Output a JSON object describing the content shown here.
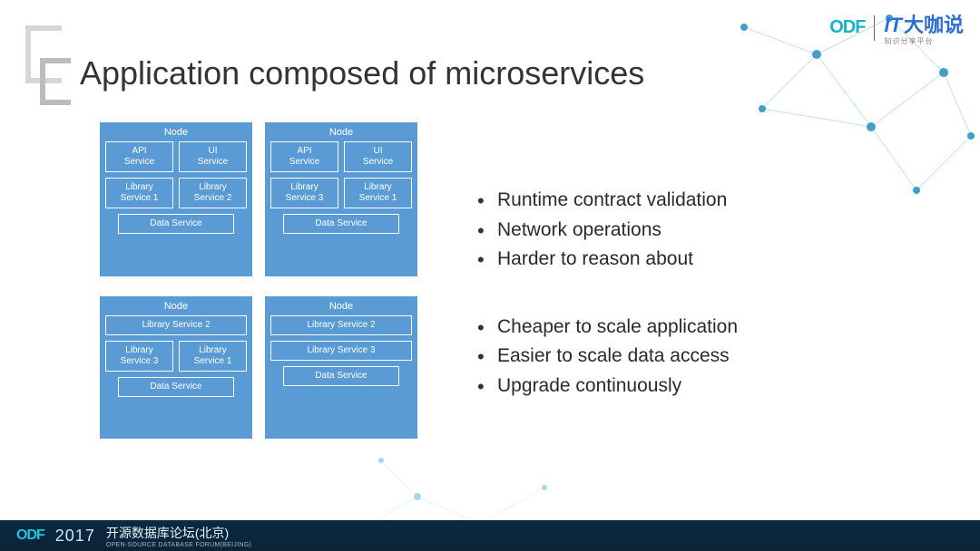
{
  "title": "Application composed of microservices",
  "header": {
    "logo1": "ODF",
    "logo2_it": "IT",
    "logo2_cn": "大咖说",
    "logo2_sub": "知识分享平台"
  },
  "nodes": [
    {
      "title": "Node",
      "rows": [
        [
          "API\nService",
          "UI\nService"
        ],
        [
          "Library\nService 1",
          "Library\nService 2"
        ]
      ],
      "bottom": "Data Service"
    },
    {
      "title": "Node",
      "rows": [
        [
          "API\nService",
          "UI\nService"
        ],
        [
          "Library\nService 3",
          "Library\nService 1"
        ]
      ],
      "bottom": "Data Service"
    },
    {
      "title": "Node",
      "rows": [
        [
          "Library Service 2"
        ],
        [
          "Library\nService 3",
          "Library\nService 1"
        ]
      ],
      "bottom": "Data Service"
    },
    {
      "title": "Node",
      "rows": [
        [
          "Library Service 2"
        ],
        [
          "Library Service 3"
        ]
      ],
      "bottom": "Data Service"
    }
  ],
  "bullets_a": [
    "Runtime contract validation",
    "Network operations",
    "Harder to reason about"
  ],
  "bullets_b": [
    "Cheaper to scale application",
    "Easier to scale data access",
    "Upgrade continuously"
  ],
  "footer": {
    "logo": "ODF",
    "year": "2017",
    "cn": "开源数据库论坛(北京)",
    "sub": "OPEN-SOURCE DATABASE FORUM(BEIJING)"
  }
}
